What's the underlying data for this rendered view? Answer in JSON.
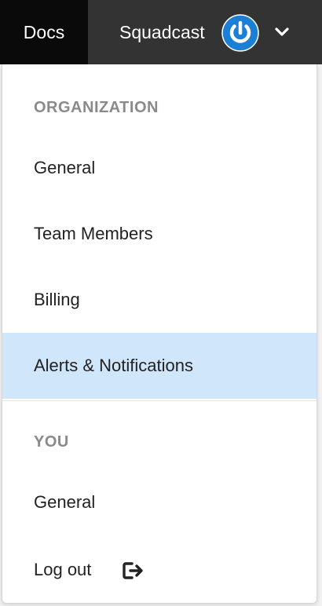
{
  "topbar": {
    "docs_label": "Docs",
    "org_name": "Squadcast",
    "logo_icon": "power-icon",
    "chevron_icon": "chevron-down-icon",
    "colors": {
      "bar": "#333333",
      "docs_bg": "#0a0a0a",
      "logo": "#1b7fd6"
    }
  },
  "dropdown": {
    "sections": [
      {
        "heading": "ORGANIZATION",
        "items": [
          {
            "label": "General",
            "active": false
          },
          {
            "label": "Team Members",
            "active": false
          },
          {
            "label": "Billing",
            "active": false
          },
          {
            "label": "Alerts & Notifications",
            "active": true
          }
        ]
      },
      {
        "heading": "YOU",
        "items": [
          {
            "label": "General",
            "active": false
          },
          {
            "label": "Log out",
            "active": false,
            "icon": "logout-icon"
          }
        ]
      }
    ],
    "colors": {
      "active_bg": "#d0e6fa",
      "heading": "#8a8a8a",
      "text": "#222222"
    }
  }
}
